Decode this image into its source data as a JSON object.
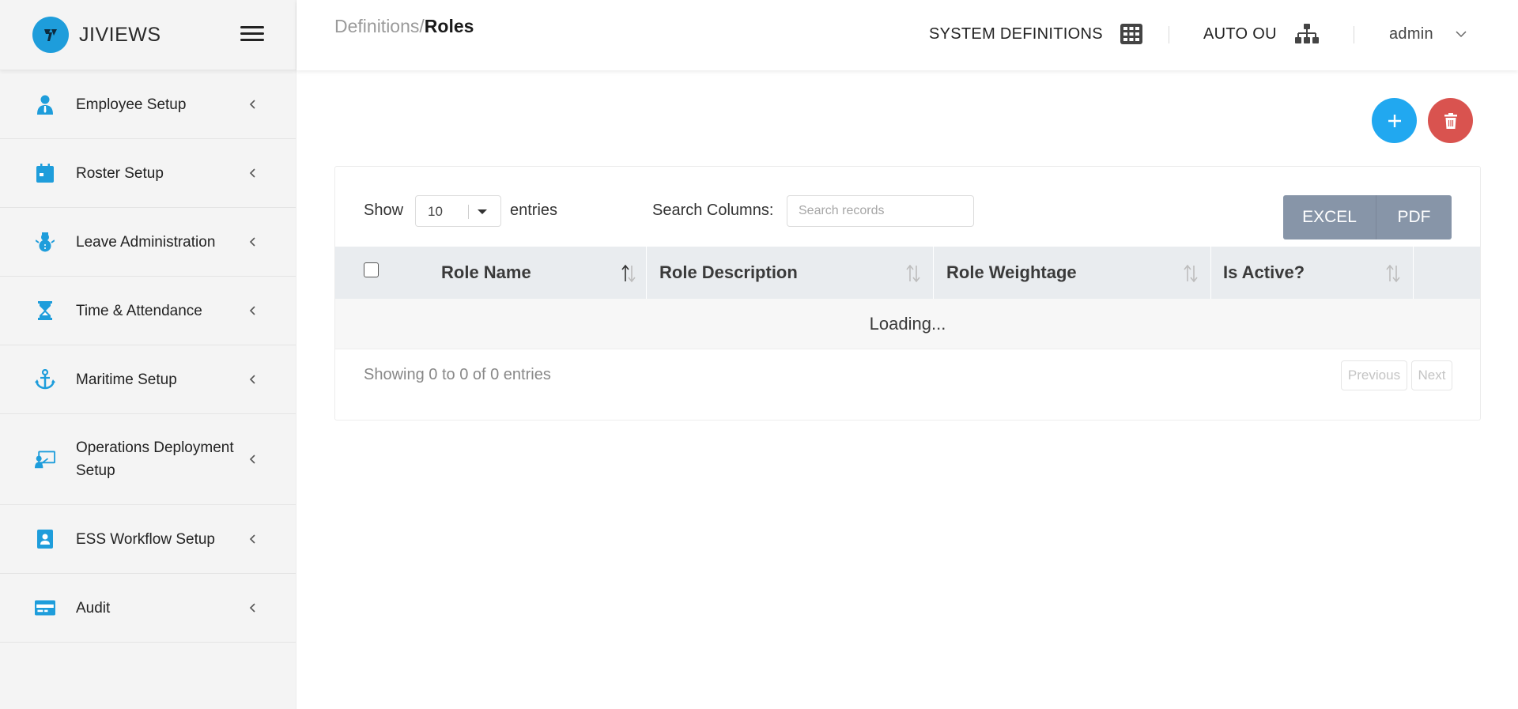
{
  "brand": {
    "name": "JIVIEWS",
    "accent": "#1e9ddb"
  },
  "sidebar": {
    "items": [
      {
        "label": "Employee Setup",
        "icon": "employee-icon"
      },
      {
        "label": "Roster Setup",
        "icon": "calendar-icon"
      },
      {
        "label": "Leave Administration",
        "icon": "snowman-icon"
      },
      {
        "label": "Time & Attendance",
        "icon": "hourglass-icon"
      },
      {
        "label": "Maritime Setup",
        "icon": "anchor-icon"
      },
      {
        "label": "Operations Deployment Setup",
        "icon": "presentation-icon"
      },
      {
        "label": "ESS Workflow Setup",
        "icon": "id-badge-icon"
      },
      {
        "label": "Audit",
        "icon": "card-icon"
      }
    ]
  },
  "header": {
    "breadcrumb_parent": "Definitions",
    "breadcrumb_sep": "/",
    "breadcrumb_current": "Roles",
    "system_definitions": "SYSTEM DEFINITIONS",
    "auto_ou": "AUTO OU",
    "user": "admin"
  },
  "actions": {
    "add_color": "#21a8f0",
    "delete_color": "#d9534f"
  },
  "table": {
    "show_label": "Show",
    "page_length": "10",
    "entries_label": "entries",
    "search_label": "Search Columns:",
    "search_placeholder": "Search records",
    "excel_label": "EXCEL",
    "pdf_label": "PDF",
    "columns": [
      "Role Name",
      "Role Description",
      "Role Weightage",
      "Is Active?"
    ],
    "loading_text": "Loading...",
    "info_text": "Showing 0 to 0 of 0 entries",
    "prev_label": "Previous",
    "next_label": "Next"
  }
}
